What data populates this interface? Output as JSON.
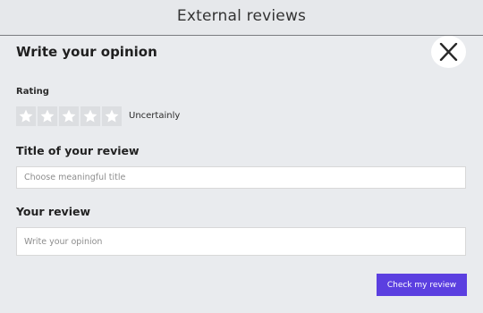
{
  "header": {
    "title": "External reviews"
  },
  "form": {
    "title": "Write your opinion",
    "close_icon": "close-x-icon",
    "rating": {
      "label": "Rating",
      "value_text": "Uncertainly",
      "max_stars": 5,
      "selected": 0,
      "icon": "star-icon"
    },
    "review_title": {
      "label": "Title of your review",
      "placeholder": "Choose meaningful title",
      "value": ""
    },
    "review_body": {
      "label": "Your review",
      "placeholder": "Write your opinion",
      "value": ""
    },
    "submit_label": "Check my review"
  },
  "colors": {
    "accent": "#5b3fe0",
    "background": "#e9ebee",
    "star_inactive": "#dcdee1"
  }
}
